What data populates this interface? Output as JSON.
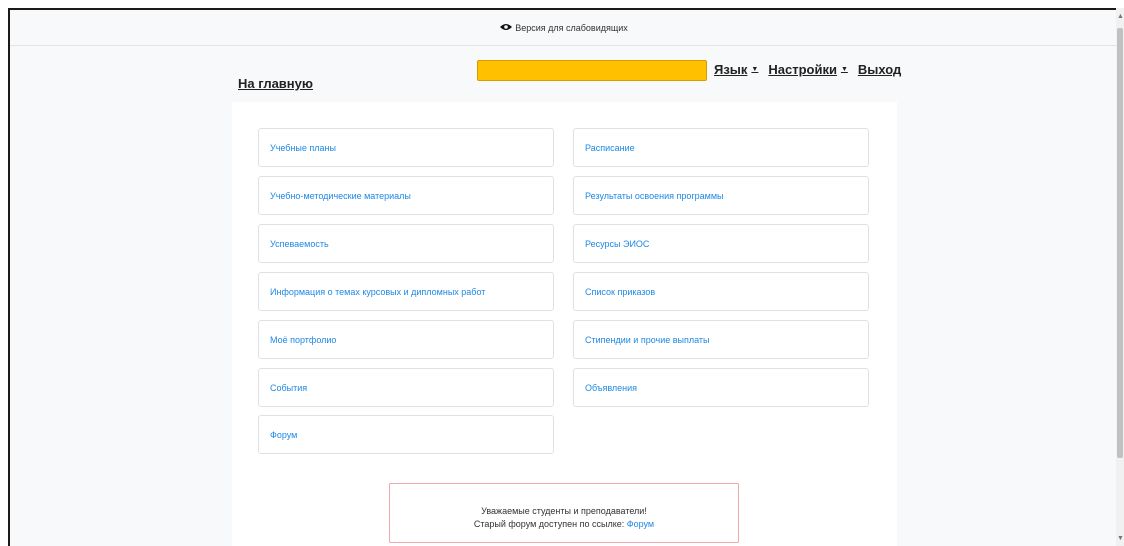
{
  "topbar": {
    "eye_icon": "eye-icon",
    "label": "Версия для слабовидящих"
  },
  "navbar": {
    "home": "На главную",
    "search_color": "#ffc000",
    "menu": [
      {
        "label": "Язык",
        "has_caret": true
      },
      {
        "label": "Настройки",
        "has_caret": true
      },
      {
        "label": "Выход",
        "has_caret": false
      }
    ]
  },
  "cards": {
    "left": [
      "Учебные планы",
      "Учебно-методические материалы",
      "Успеваемость",
      "Информация о темах курсовых и дипломных работ",
      "Моё портфолио",
      "События",
      "Форум"
    ],
    "right": [
      "Расписание",
      "Результаты освоения программы",
      "Ресурсы ЭИОС",
      "Список приказов",
      "Стипендии и прочие выплаты",
      "Объявления"
    ]
  },
  "notice": {
    "line1": "Уважаемые студенты и преподаватели!",
    "line2_prefix": "Старый форум доступен по ссылке:",
    "link_label": "Форум"
  },
  "colors": {
    "link": "#1e88e5",
    "notice_border": "#f3a6ad",
    "page_bg": "#f8f9fa"
  }
}
